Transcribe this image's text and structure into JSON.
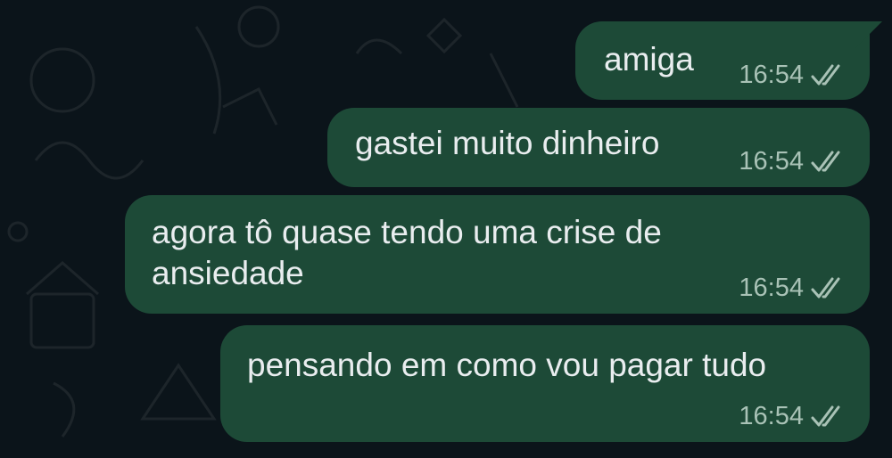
{
  "chat": {
    "messages": [
      {
        "text": "amiga",
        "time": "16:54",
        "status": "read-double-check-icon"
      },
      {
        "text": "gastei muito dinheiro",
        "time": "16:54",
        "status": "read-double-check-icon"
      },
      {
        "text": "agora tô quase tendo uma crise de\nansiedade",
        "time": "16:54",
        "status": "read-double-check-icon"
      },
      {
        "text": "pensando em como vou pagar tudo",
        "time": "16:54",
        "status": "read-double-check-icon"
      }
    ]
  },
  "colors": {
    "background": "#0b141a",
    "outgoing_bubble": "#1d4a37",
    "message_text": "#e9edef",
    "meta_text": "#a9c2b6"
  }
}
